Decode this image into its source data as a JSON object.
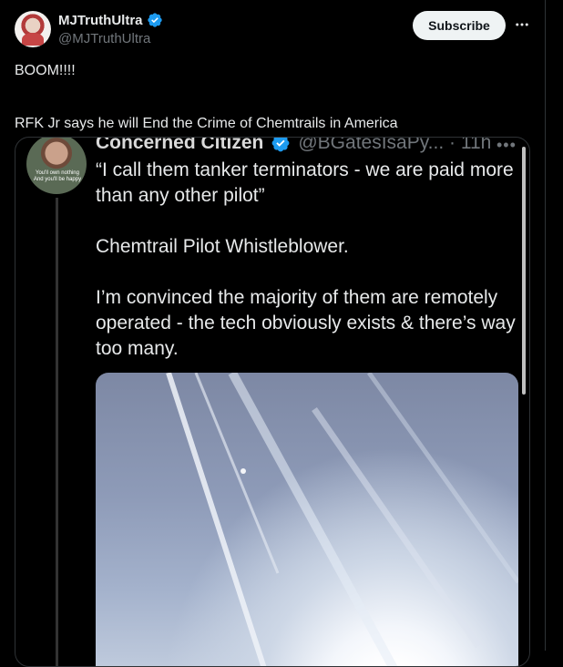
{
  "header": {
    "display_name": "MJTruthUltra",
    "handle": "@MJTruthUltra",
    "subscribe_label": "Subscribe"
  },
  "tweet": {
    "line1": "BOOM!!!!",
    "line2": "RFK Jr says he will End the Crime of Chemtrails in America"
  },
  "quoted": {
    "name": "Concerned Citizen",
    "handle_time": "@BGatesIsaPy... · 11h",
    "avatar_caption": "You'll own nothing And you'll be happy",
    "body1": "“I call them tanker terminators - we are paid more than any other pilot”",
    "body2": "Chemtrail Pilot Whistleblower.",
    "body3": "I’m convinced the majority of them are remotely operated - the tech obviously exists & there’s way too many."
  },
  "colors": {
    "background": "#000000",
    "verified_badge": "#1d9bf0",
    "secondary_text": "#71767b"
  },
  "icons": {
    "verified": "verified-badge-icon",
    "more": "more-horizontal-icon"
  }
}
